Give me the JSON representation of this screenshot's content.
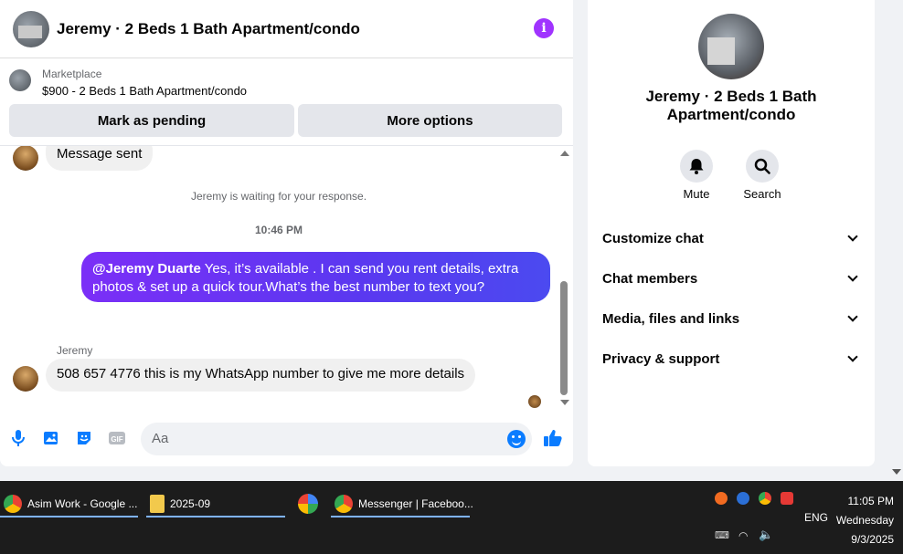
{
  "chat": {
    "title": "Jeremy · 2 Beds 1 Bath Apartment/condo",
    "info_icon": "i",
    "marketplace_label": "Marketplace",
    "marketplace_item": "$900 - 2 Beds 1 Bath Apartment/condo",
    "btn_pending": "Mark as pending",
    "btn_more": "More options",
    "messages": {
      "first_in": "Message sent",
      "waiting": "Jeremy is waiting for your response.",
      "timestamp": "10:46 PM",
      "out_mention": "@Jeremy Duarte",
      "out_text": " Yes, it’s available .  I can send you rent details, extra photos & set up a quick tour.What’s the best number to text you?",
      "sender": "Jeremy",
      "last_in": "508 657 4776 this is my WhatsApp number to give me more details"
    },
    "composer_placeholder": "Aa",
    "gif_label": "GIF"
  },
  "info_panel": {
    "title": "Jeremy · 2 Beds 1 Bath Apartment/condo",
    "mute": "Mute",
    "search": "Search",
    "rows": [
      "Customize chat",
      "Chat members",
      "Media, files and links",
      "Privacy & support"
    ]
  },
  "taskbar": {
    "tasks": [
      "Asim Work - Google ...",
      "2025-09",
      "Messenger | Faceboo..."
    ],
    "lang": "ENG",
    "time": "11:05 PM",
    "day": "Wednesday",
    "date": "9/3/2025"
  },
  "colors": {
    "accent": "#0a7cff",
    "outgoing_start": "#7b2ff7",
    "outgoing_end": "#4b4af0",
    "info": "#a033ff"
  }
}
